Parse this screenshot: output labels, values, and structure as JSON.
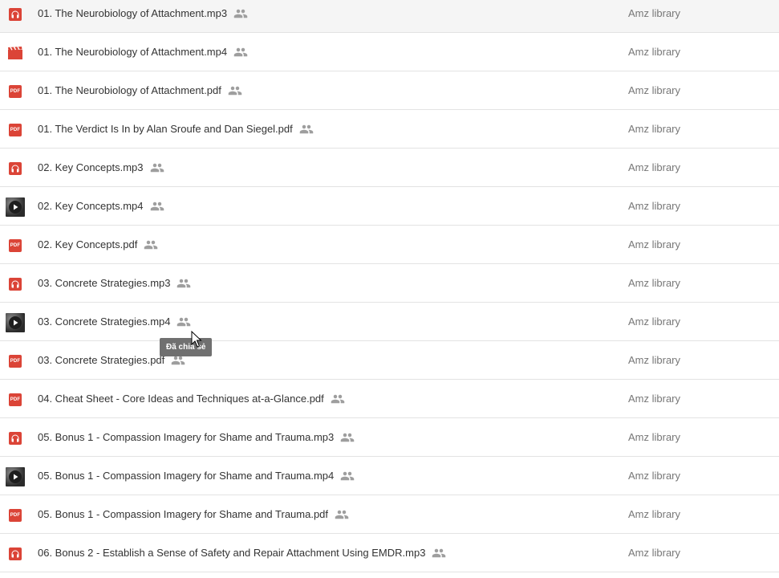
{
  "files": [
    {
      "name": "01. The Neurobiology of Attachment.mp3",
      "type": "audio",
      "owner": "Amz library"
    },
    {
      "name": "01. The Neurobiology of Attachment.mp4",
      "type": "video-red",
      "owner": "Amz library"
    },
    {
      "name": "01. The Neurobiology of Attachment.pdf",
      "type": "pdf",
      "owner": "Amz library"
    },
    {
      "name": "01. The Verdict Is In by Alan Sroufe and Dan Siegel.pdf",
      "type": "pdf",
      "owner": "Amz library"
    },
    {
      "name": "02. Key Concepts.mp3",
      "type": "audio",
      "owner": "Amz library"
    },
    {
      "name": "02. Key Concepts.mp4",
      "type": "video-thumb",
      "owner": "Amz library"
    },
    {
      "name": "02. Key Concepts.pdf",
      "type": "pdf",
      "owner": "Amz library"
    },
    {
      "name": "03. Concrete Strategies.mp3",
      "type": "audio",
      "owner": "Amz library"
    },
    {
      "name": "03. Concrete Strategies.mp4",
      "type": "video-thumb",
      "owner": "Amz library"
    },
    {
      "name": "03. Concrete Strategies.pdf",
      "type": "pdf",
      "owner": "Amz library"
    },
    {
      "name": "04. Cheat Sheet - Core Ideas and Techniques at-a-Glance.pdf",
      "type": "pdf",
      "owner": "Amz library"
    },
    {
      "name": "05. Bonus 1 - Compassion Imagery for Shame and Trauma.mp3",
      "type": "audio",
      "owner": "Amz library"
    },
    {
      "name": "05. Bonus 1 - Compassion Imagery for Shame and Trauma.mp4",
      "type": "video-thumb",
      "owner": "Amz library"
    },
    {
      "name": "05. Bonus 1 - Compassion Imagery for Shame and Trauma.pdf",
      "type": "pdf",
      "owner": "Amz library"
    },
    {
      "name": "06. Bonus 2 - Establish a Sense of Safety and Repair Attachment Using EMDR.mp3",
      "type": "audio",
      "owner": "Amz library"
    }
  ],
  "pdf_icon_text": "PDF",
  "tooltip": {
    "text": "Đã chia sẻ"
  },
  "colors": {
    "accent_red": "#db4437",
    "owner_text": "#777777",
    "divider": "#e3e3e3",
    "tooltip_bg": "#707070"
  }
}
